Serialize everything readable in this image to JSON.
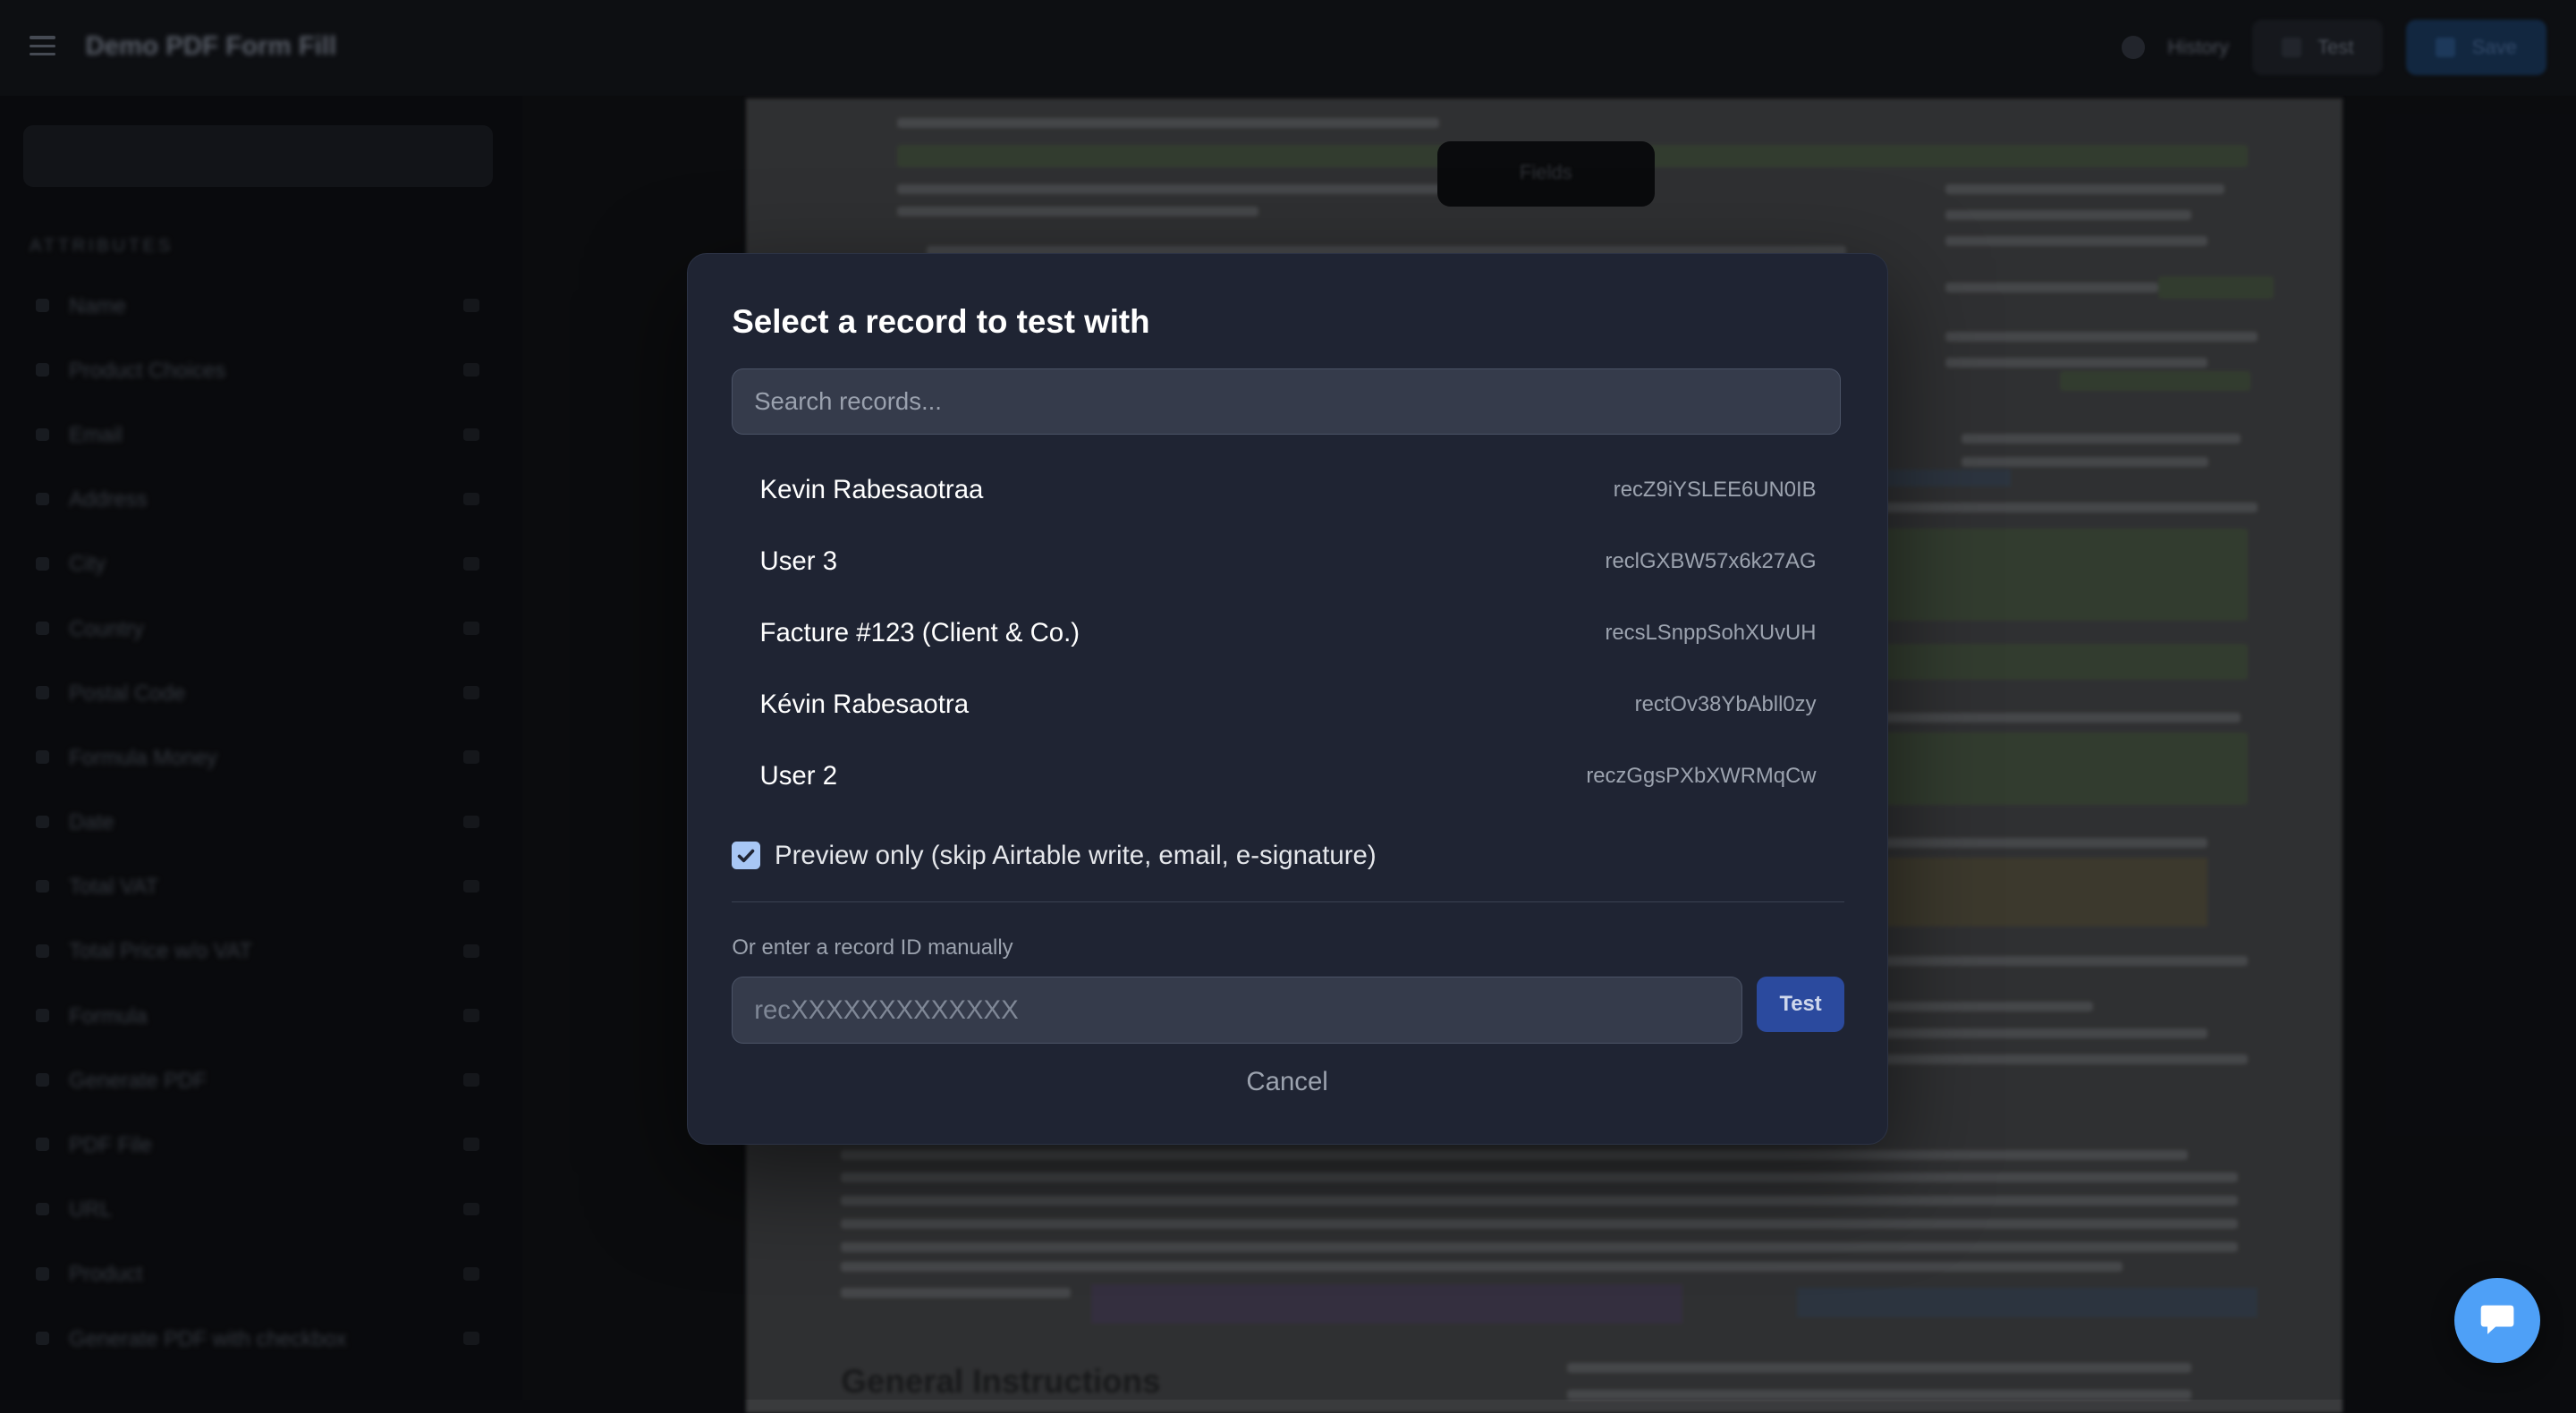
{
  "topbar": {
    "title": "Demo PDF Form Fill",
    "history_label": "History",
    "test_label": "Test",
    "save_label": "Save"
  },
  "sidebar": {
    "section_label": "ATTRIBUTES",
    "items": [
      {
        "label": "Name"
      },
      {
        "label": "Product Choices"
      },
      {
        "label": "Email"
      },
      {
        "label": "Address"
      },
      {
        "label": "City"
      },
      {
        "label": "Country"
      },
      {
        "label": "Postal Code"
      },
      {
        "label": "Formula Money"
      },
      {
        "label": "Date"
      },
      {
        "label": "Total VAT"
      },
      {
        "label": "Total Price w/o VAT"
      },
      {
        "label": "Formula"
      },
      {
        "label": "Generate PDF"
      },
      {
        "label": "PDF File"
      },
      {
        "label": "URL"
      },
      {
        "label": "Product"
      },
      {
        "label": "Generate PDF with checkbox"
      }
    ]
  },
  "preview": {
    "toolbar_label": "Fields",
    "section_heading": "General Instructions"
  },
  "modal": {
    "title": "Select a record to test with",
    "search_placeholder": "Search records...",
    "records": [
      {
        "name": "Kevin Rabesaotraa",
        "id": "recZ9iYSLEE6UN0IB"
      },
      {
        "name": "User 3",
        "id": "reclGXBW57x6k27AG"
      },
      {
        "name": "Facture #123 (Client & Co.)",
        "id": "recsLSnppSohXUvUH"
      },
      {
        "name": "Kévin Rabesaotra",
        "id": "rectOv38YbAbll0zy"
      },
      {
        "name": "User 2",
        "id": "reczGgsPXbXWRMqCw"
      }
    ],
    "preview_only_label": "Preview only (skip Airtable write, email, e-signature)",
    "preview_only_checked": true,
    "manual_label": "Or enter a record ID manually",
    "manual_placeholder": "recXXXXXXXXXXXXX",
    "test_button": "Test",
    "cancel_button": "Cancel"
  },
  "colors": {
    "modal_bg": "#1f2433",
    "accent": "#2b4a9e",
    "checkbox": "#a8c7f5",
    "chat_button": "#4ea0f7"
  },
  "icons": [
    "menu-icon",
    "history-icon",
    "test-icon",
    "save-icon",
    "checkmark-icon",
    "chat-icon"
  ]
}
